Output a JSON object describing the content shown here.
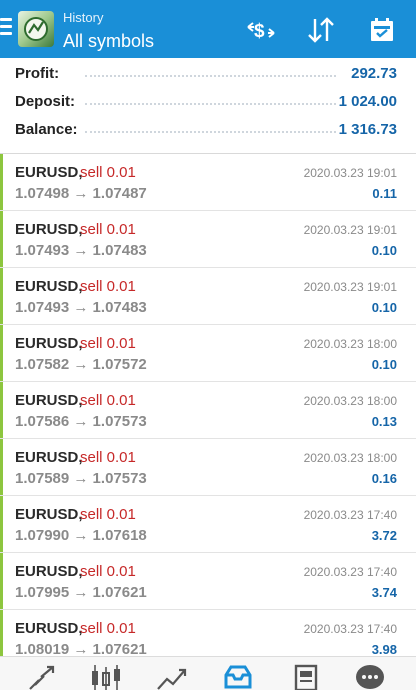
{
  "header": {
    "title": "History",
    "subtitle": "All symbols",
    "accent_color": "#1a8fd7",
    "icons": [
      "menu-icon",
      "app-logo",
      "currency-filter-icon",
      "sort-icon",
      "calendar-icon"
    ]
  },
  "summary": {
    "profit_label": "Profit:",
    "profit_value": "292.73",
    "deposit_label": "Deposit:",
    "deposit_value": "1 024.00",
    "balance_label": "Balance:",
    "balance_value": "1 316.73"
  },
  "deals": [
    {
      "symbol": "EURUSD,",
      "type": "sell 0.01",
      "prices": "1.07498 → 1.07487",
      "time": "2020.03.23 19:01",
      "profit": "0.11"
    },
    {
      "symbol": "EURUSD,",
      "type": "sell 0.01",
      "prices": "1.07493 → 1.07483",
      "time": "2020.03.23 19:01",
      "profit": "0.10"
    },
    {
      "symbol": "EURUSD,",
      "type": "sell 0.01",
      "prices": "1.07493 → 1.07483",
      "time": "2020.03.23 19:01",
      "profit": "0.10"
    },
    {
      "symbol": "EURUSD,",
      "type": "sell 0.01",
      "prices": "1.07582 → 1.07572",
      "time": "2020.03.23 18:00",
      "profit": "0.10"
    },
    {
      "symbol": "EURUSD,",
      "type": "sell 0.01",
      "prices": "1.07586 → 1.07573",
      "time": "2020.03.23 18:00",
      "profit": "0.13"
    },
    {
      "symbol": "EURUSD,",
      "type": "sell 0.01",
      "prices": "1.07589 → 1.07573",
      "time": "2020.03.23 18:00",
      "profit": "0.16"
    },
    {
      "symbol": "EURUSD,",
      "type": "sell 0.01",
      "prices": "1.07990 → 1.07618",
      "time": "2020.03.23 17:40",
      "profit": "3.72"
    },
    {
      "symbol": "EURUSD,",
      "type": "sell 0.01",
      "prices": "1.07995 → 1.07621",
      "time": "2020.03.23 17:40",
      "profit": "3.74"
    },
    {
      "symbol": "EURUSD,",
      "type": "sell 0.01",
      "prices": "1.08019 → 1.07621",
      "time": "2020.03.23 17:40",
      "profit": "3.98"
    }
  ],
  "colors": {
    "profit_blue": "#1565a8",
    "sell_red": "#c62828",
    "deal_bar_green": "#8dc63f"
  },
  "bottom_nav": [
    "quotes-icon",
    "chart-icon",
    "trade-icon",
    "history-icon",
    "news-icon",
    "messages-icon"
  ]
}
